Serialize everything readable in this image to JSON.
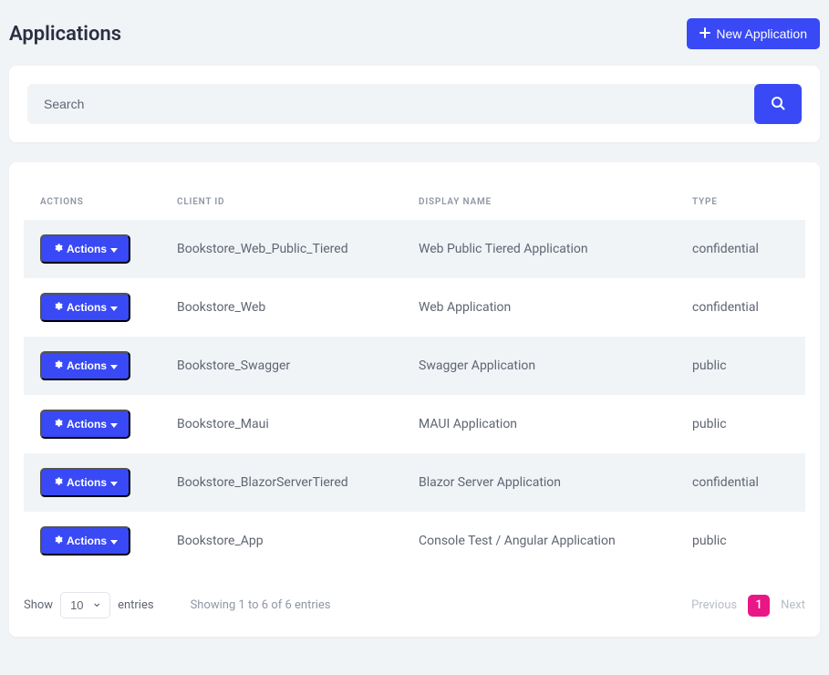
{
  "header": {
    "title": "Applications",
    "new_button": "New Application"
  },
  "search": {
    "placeholder": "Search"
  },
  "table": {
    "columns": {
      "actions": "Actions",
      "client_id": "Client Id",
      "display_name": "Display Name",
      "type": "Type"
    },
    "action_button": "Actions",
    "rows": [
      {
        "client_id": "Bookstore_Web_Public_Tiered",
        "display_name": "Web Public Tiered Application",
        "type": "confidential"
      },
      {
        "client_id": "Bookstore_Web",
        "display_name": "Web Application",
        "type": "confidential"
      },
      {
        "client_id": "Bookstore_Swagger",
        "display_name": "Swagger Application",
        "type": "public"
      },
      {
        "client_id": "Bookstore_Maui",
        "display_name": "MAUI Application",
        "type": "public"
      },
      {
        "client_id": "Bookstore_BlazorServerTiered",
        "display_name": "Blazor Server Application",
        "type": "confidential"
      },
      {
        "client_id": "Bookstore_App",
        "display_name": "Console Test / Angular Application",
        "type": "public"
      }
    ]
  },
  "footer": {
    "show_label": "Show",
    "entries_label": "entries",
    "page_size": "10",
    "info": "Showing 1 to 6 of 6 entries",
    "prev": "Previous",
    "current_page": "1",
    "next": "Next"
  }
}
